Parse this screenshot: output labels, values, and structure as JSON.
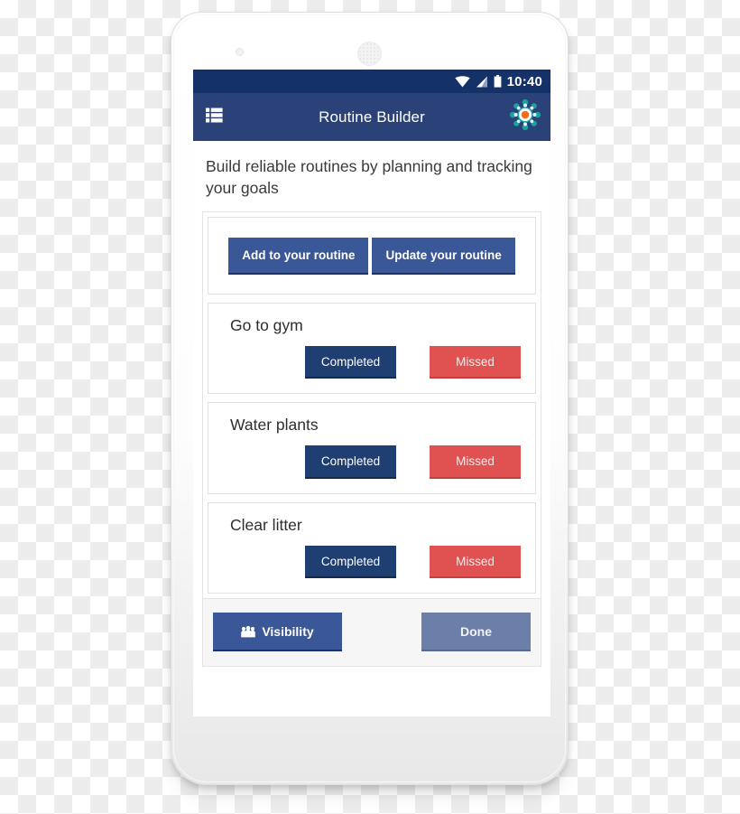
{
  "device": {
    "type": "android-phone-mockup",
    "camera_icon": "camera-dot",
    "speaker_icon": "speaker-grille"
  },
  "status_bar": {
    "time": "10:40",
    "icons": [
      "wifi-icon",
      "signal-icon",
      "battery-icon"
    ],
    "background": "#143168"
  },
  "app_bar": {
    "title": "Routine Builder",
    "menu_icon": "list-menu-icon",
    "settings_icon": "gear-settings-icon",
    "background": "#2a4277"
  },
  "intro": {
    "text": "Build reliable routines by planning and tracking your goals"
  },
  "actions": {
    "add_label": "Add to your routine",
    "update_label": "Update your routine"
  },
  "tasks": [
    {
      "title": "Go to gym",
      "completed_label": "Completed",
      "missed_label": "Missed"
    },
    {
      "title": "Water plants",
      "completed_label": "Completed",
      "missed_label": "Missed"
    },
    {
      "title": "Clear litter",
      "completed_label": "Completed",
      "missed_label": "Missed"
    }
  ],
  "footer": {
    "visibility_label": "Visibility",
    "visibility_icon": "group-people-icon",
    "done_label": "Done"
  },
  "colors": {
    "primary_blue": "#3a5897",
    "dark_navy": "#1f3f73",
    "status_navy": "#143168",
    "appbar_navy": "#2a4277",
    "missed_red": "#e05252",
    "done_muted": "#6b7fa8",
    "gear_teal": "#1a9a9a",
    "gear_orange": "#ef6c1a"
  }
}
